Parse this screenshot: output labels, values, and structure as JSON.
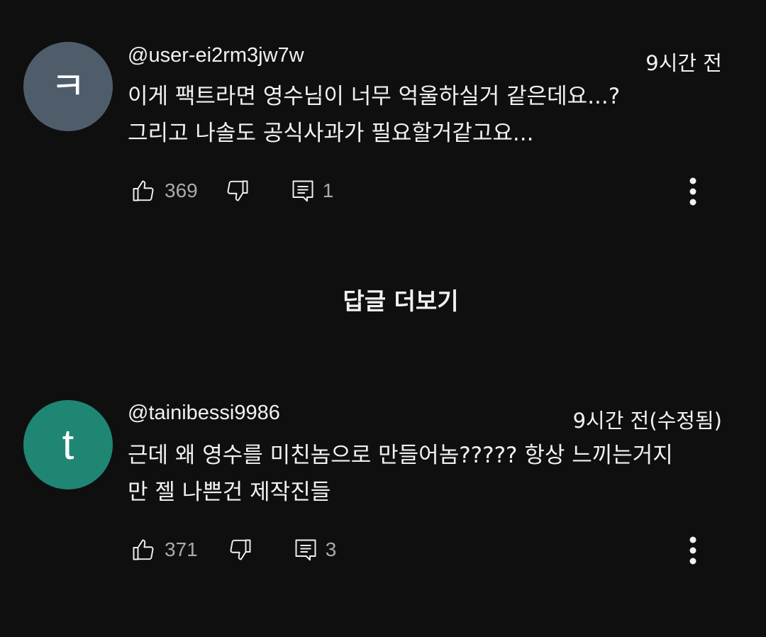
{
  "comments": [
    {
      "author": "@user-ei2rm3jw7w",
      "time": "9시간 전",
      "avatar_letter": "ㅋ",
      "avatar_color": "#4f5d6b",
      "lines": [
        "이게 팩트라면 영수님이 너무 억울하실거 같은데요...?",
        "그리고 나솔도 공식사과가 필요할거같고요..."
      ],
      "likes": "369",
      "replies": "1"
    },
    {
      "author": "@tainibessi9986",
      "time": "9시간 전(수정됨)",
      "avatar_letter": "t",
      "avatar_color": "#1f8674",
      "lines": [
        "근데 왜 영수를 미친놈으로 만들어놈????? 항상 느끼는거지",
        "만 젤 나쁜건 제작진들"
      ],
      "likes": "371",
      "replies": "3"
    }
  ],
  "show_more_replies": "답글 더보기",
  "icons": {
    "like": "thumb-up-icon",
    "dislike": "thumb-down-icon",
    "reply": "reply-icon",
    "more": "more-vert-icon"
  }
}
